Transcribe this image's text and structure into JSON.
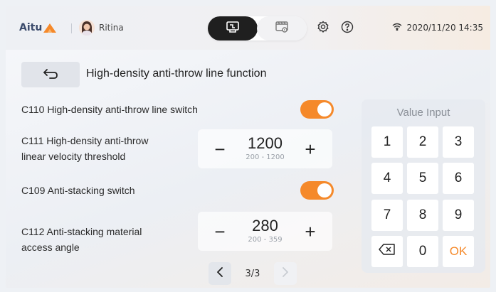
{
  "topbar": {
    "logo_text": "Aitu",
    "user_name": "Ritina",
    "datetime": "2020/11/20 14:35",
    "icons": [
      "sewing-mode-icon",
      "video-mode-icon",
      "settings-icon",
      "help-icon",
      "wifi-icon"
    ]
  },
  "header": {
    "title": "High-density anti-throw line function"
  },
  "settings": [
    {
      "label": "C110 High-density anti-throw line switch",
      "type": "toggle",
      "on": true
    },
    {
      "label_line1": "C111 High-density anti-throw",
      "label_line2": "linear velocity threshold",
      "type": "stepper",
      "value": "1200",
      "range": "200 - 1200"
    },
    {
      "label": "C109 Anti-stacking switch",
      "type": "toggle",
      "on": true
    },
    {
      "label_line1": "C112 Anti-stacking material",
      "label_line2": "access angle",
      "type": "stepper",
      "value": "280",
      "range": "200 - 359"
    }
  ],
  "stepper_symbols": {
    "minus": "−",
    "plus": "+"
  },
  "pagination": {
    "text": "3/3",
    "current": 3,
    "total": 3
  },
  "keypad": {
    "title": "Value Input",
    "keys": [
      "1",
      "2",
      "3",
      "4",
      "5",
      "6",
      "7",
      "8",
      "9",
      "backspace",
      "0",
      "OK"
    ],
    "ok_label": "OK"
  },
  "colors": {
    "accent": "#f5892a",
    "dark_button": "#1f1f1f"
  }
}
